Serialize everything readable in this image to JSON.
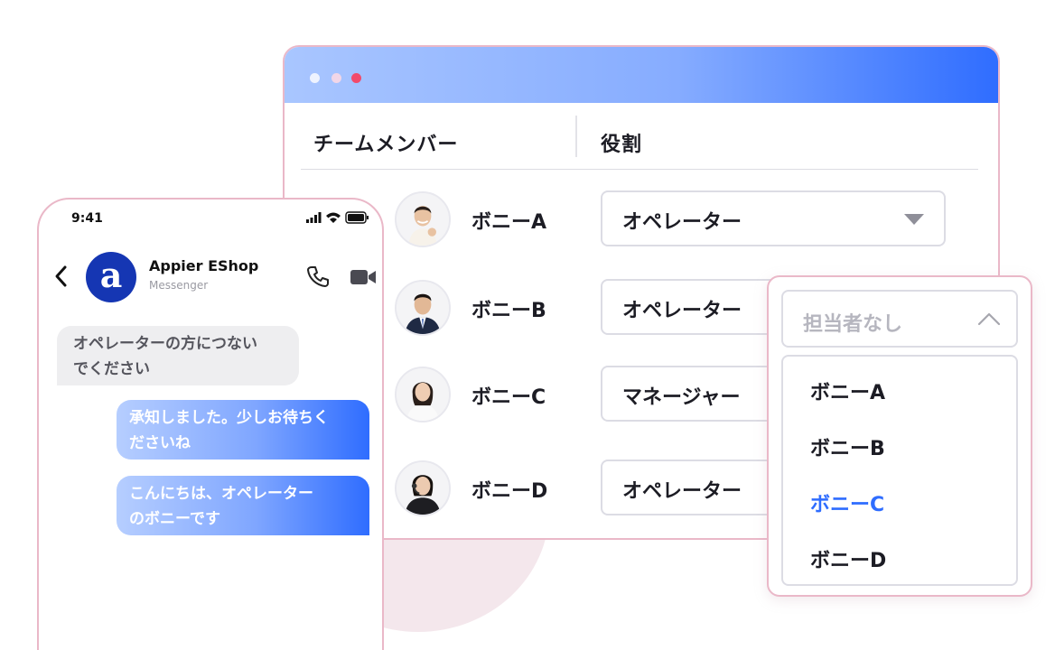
{
  "window": {
    "columns": {
      "member": "チームメンバー",
      "role": "役割"
    },
    "members": [
      {
        "name": "ボニーA",
        "role": "オペレーター"
      },
      {
        "name": "ボニーB",
        "role": "オペレーター"
      },
      {
        "name": "ボニーC",
        "role": "マネージャー"
      },
      {
        "name": "ボニーD",
        "role": "オペレーター"
      }
    ]
  },
  "dropdown": {
    "placeholder": "担当者なし",
    "options": [
      "ボニーA",
      "ボニーB",
      "ボニーC",
      "ボニーD"
    ],
    "selected": "ボニーC",
    "accent_color": "#2f6dff"
  },
  "phone": {
    "time": "9:41",
    "chat_title": "Appier EShop",
    "chat_subtitle": "Messenger",
    "avatar_letter": "a",
    "messages": [
      {
        "from": "user",
        "lines": [
          "オペレーターの方につない",
          "でください"
        ]
      },
      {
        "from": "bot",
        "lines": [
          "承知しました。少しお待ちく",
          "ださいね"
        ]
      },
      {
        "from": "bot",
        "lines": [
          "こんにちは、オペレーター",
          "のボニーです"
        ]
      }
    ]
  }
}
